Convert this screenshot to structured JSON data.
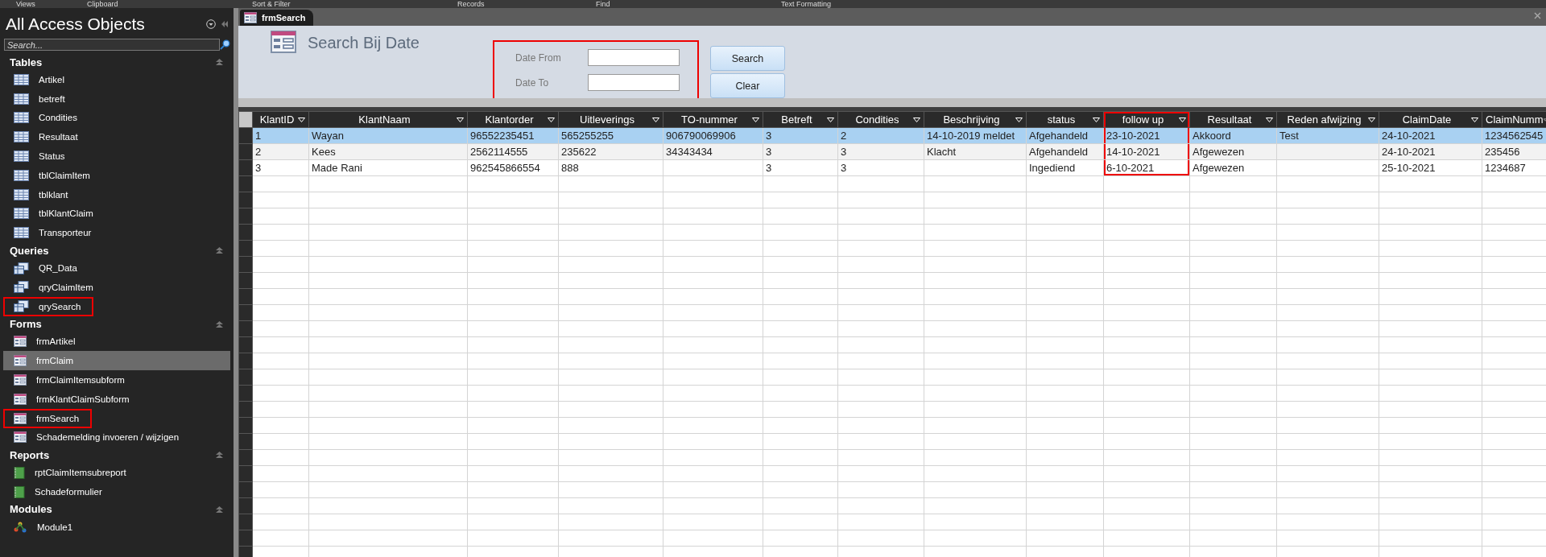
{
  "ribbon_groups": [
    "Views",
    "Clipboard",
    "Sort & Filter",
    "Records",
    "Find",
    "Text Formatting"
  ],
  "navigation": {
    "title": "All Access Objects",
    "search": {
      "placeholder": "Search..."
    },
    "groups": [
      {
        "label": "Tables",
        "kind": "table",
        "items": [
          {
            "label": "Artikel",
            "selected": false,
            "highlighted": false
          },
          {
            "label": "betreft",
            "selected": false,
            "highlighted": false
          },
          {
            "label": "Condities",
            "selected": false,
            "highlighted": false
          },
          {
            "label": "Resultaat",
            "selected": false,
            "highlighted": false
          },
          {
            "label": "Status",
            "selected": false,
            "highlighted": false
          },
          {
            "label": "tblClaimItem",
            "selected": false,
            "highlighted": false
          },
          {
            "label": "tblklant",
            "selected": false,
            "highlighted": false
          },
          {
            "label": "tblKlantClaim",
            "selected": false,
            "highlighted": false
          },
          {
            "label": "Transporteur",
            "selected": false,
            "highlighted": false
          }
        ]
      },
      {
        "label": "Queries",
        "kind": "query",
        "items": [
          {
            "label": "QR_Data",
            "selected": false,
            "highlighted": false
          },
          {
            "label": "qryClaimItem",
            "selected": false,
            "highlighted": false
          },
          {
            "label": "qrySearch",
            "selected": false,
            "highlighted": true
          }
        ]
      },
      {
        "label": "Forms",
        "kind": "form",
        "items": [
          {
            "label": "frmArtikel",
            "selected": false,
            "highlighted": false
          },
          {
            "label": "frmClaim",
            "selected": true,
            "highlighted": false
          },
          {
            "label": "frmClaimItemsubform",
            "selected": false,
            "highlighted": false
          },
          {
            "label": "frmKlantClaimSubform",
            "selected": false,
            "highlighted": false
          },
          {
            "label": "frmSearch",
            "selected": false,
            "highlighted": true
          },
          {
            "label": "Schademelding invoeren / wijzigen",
            "selected": false,
            "highlighted": false
          }
        ]
      },
      {
        "label": "Reports",
        "kind": "report",
        "items": [
          {
            "label": "rptClaimItemsubreport",
            "selected": false,
            "highlighted": false
          },
          {
            "label": "Schadeformulier",
            "selected": false,
            "highlighted": false
          }
        ]
      },
      {
        "label": "Modules",
        "kind": "module",
        "items": [
          {
            "label": "Module1",
            "selected": false,
            "highlighted": false
          }
        ]
      }
    ]
  },
  "tab": {
    "label": "frmSearch"
  },
  "form": {
    "title": "Search Bij Date",
    "filter_highlighted": true,
    "fields": [
      {
        "label": "Date From"
      },
      {
        "label": "Date To"
      }
    ],
    "buttons": [
      "Search",
      "Clear"
    ]
  },
  "datasheet": {
    "columns": [
      {
        "label": "KlantID",
        "highlighted": false
      },
      {
        "label": "KlantNaam",
        "highlighted": false
      },
      {
        "label": "Klantorder",
        "highlighted": false
      },
      {
        "label": "Uitleverings",
        "highlighted": false
      },
      {
        "label": "TO-nummer",
        "highlighted": false
      },
      {
        "label": "Betreft",
        "highlighted": false
      },
      {
        "label": "Condities",
        "highlighted": false
      },
      {
        "label": "Beschrijving",
        "highlighted": false
      },
      {
        "label": "status",
        "highlighted": false
      },
      {
        "label": "follow up",
        "highlighted": true
      },
      {
        "label": "Resultaat",
        "highlighted": false
      },
      {
        "label": "Reden afwijzing",
        "highlighted": false
      },
      {
        "label": "ClaimDate",
        "highlighted": false
      },
      {
        "label": "ClaimNumm",
        "highlighted": false
      }
    ],
    "rows": [
      {
        "selected": true,
        "cells": [
          "1",
          "Wayan",
          "96552235451",
          "565255255",
          "906790069906",
          "3",
          "2",
          "14-10-2019 meldet",
          "Afgehandeld",
          "23-10-2021",
          "Akkoord",
          "Test",
          "24-10-2021",
          "1234562545"
        ]
      },
      {
        "selected": false,
        "cells": [
          "2",
          "Kees",
          "2562114555",
          "235622",
          "34343434",
          "3",
          "3",
          "Klacht",
          "Afgehandeld",
          "14-10-2021",
          "Afgewezen",
          "",
          "24-10-2021",
          "235456"
        ]
      },
      {
        "selected": false,
        "cells": [
          "3",
          "Made Rani",
          "962545866554",
          "888",
          "",
          "3",
          "3",
          "",
          "Ingediend",
          "6-10-2021",
          "Afgewezen",
          "",
          "25-10-2021",
          "1234687"
        ]
      }
    ]
  }
}
